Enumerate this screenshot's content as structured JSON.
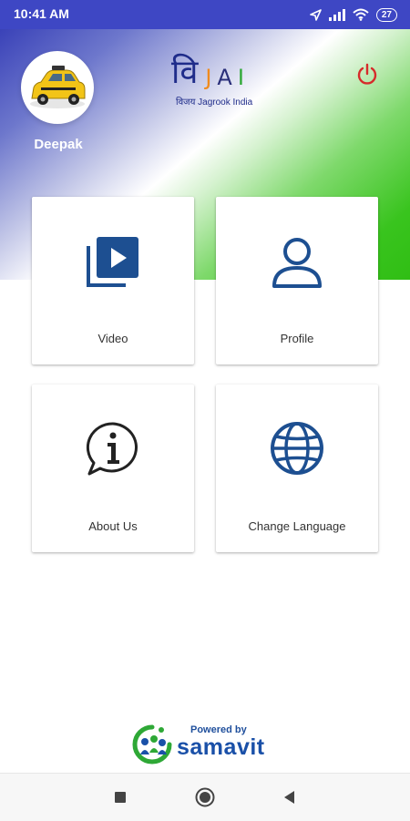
{
  "status_bar": {
    "time": "10:41 AM",
    "battery": "27",
    "icons": [
      "location-icon",
      "signal-icon",
      "wifi-icon",
      "battery-icon"
    ]
  },
  "header": {
    "user_name": "Deepak",
    "logo": {
      "main": [
        "वि",
        "J",
        "A",
        "I"
      ],
      "subtitle": "विजय Jagrook India"
    },
    "avatar_icon": "taxi-car-icon",
    "power_icon": "power-icon"
  },
  "menu": {
    "cards": [
      {
        "label": "Video",
        "icon": "video-library-icon"
      },
      {
        "label": "Profile",
        "icon": "person-icon"
      },
      {
        "label": "About Us",
        "icon": "info-chat-icon"
      },
      {
        "label": "Change Language",
        "icon": "globe-icon"
      }
    ]
  },
  "footer": {
    "powered_by": "Powered by",
    "brand": "samavit"
  },
  "nav": {
    "icons": [
      "recents-square-icon",
      "home-circle-icon",
      "back-triangle-icon"
    ]
  },
  "colors": {
    "status_bar": "#3e47c4",
    "icon_blue": "#1d4f91",
    "power_red": "#d62b2b",
    "gradient_blue": "#3a42b8",
    "gradient_green": "#30be14"
  }
}
